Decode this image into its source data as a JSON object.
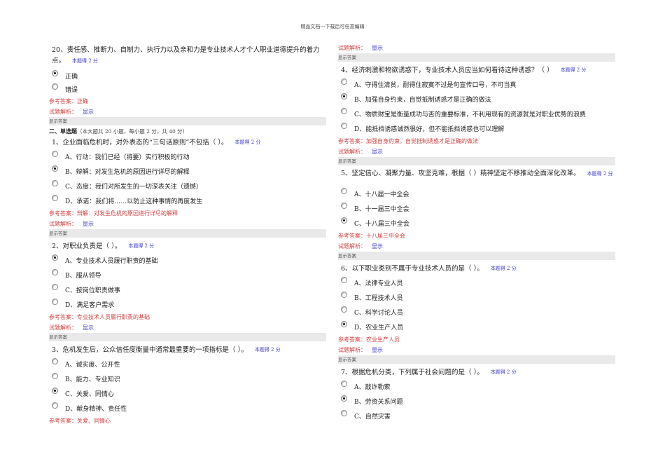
{
  "header": "精品文档---下载后可任意编辑",
  "labels": {
    "ref": "参考答案：",
    "analysis": "试题解析：",
    "show": "显示",
    "show_answer": "显示答案"
  },
  "section": {
    "title": "二、单选题",
    "note": "（本大题共 20 小题，每小题 2 分，共 40 分）"
  },
  "q20": {
    "text": "20、责任感、推断力、自制力、执行力以及亲和力是专业技术人才个人职业道德提升的着力点。",
    "score": "本题得 2 分",
    "options": [
      "正确",
      "错误"
    ],
    "selected": 0,
    "answer": "正确"
  },
  "left": [
    {
      "text": "1、企业面临危机时，对外表态的“三句话原则”不包括（ ）。",
      "score": "本题得 2 分",
      "options": [
        "A、行动：我们已经（将要）实行积极的行动",
        "B、辩解：对发生危机的原因进行详尽的解释",
        "C、态度：我们对所发生的一切深表关注（遗憾）",
        "D、承诺：我们将……以防止这种事情的再度发生"
      ],
      "selected": 1,
      "answer": "辩解：对发生危机的原因进行详尽的解释"
    },
    {
      "text": "2、对职业负责是（ ）。",
      "score": "本题得 2 分",
      "options": [
        "A、专业技术人员履行职责的基础",
        "B、服从领导",
        "C、按岗位职责做事",
        "D、满足客户需求"
      ],
      "selected": 0,
      "answer": "专业技术人员履行职责的基础"
    },
    {
      "text": "3、危机发生后，公众信任度衡量中通常最重要的一项指标是（ ）。",
      "score": "本题得 2 分",
      "options": [
        "A、诚实度、公开性",
        "B、能力、专业知识",
        "C、关爱、同情心",
        "D、献身精神、责任性"
      ],
      "selected": 2,
      "answer": "关爱、同情心"
    }
  ],
  "right": [
    {
      "text": "4、经济刺激和物欲诱惑下，专业技术人员应当如何看待这种诱惑？（ ）",
      "score": "本题得 2 分",
      "options": [
        "A、守得住清贫，耐得住寂寞不过是句宣传口号，不可当真",
        "B、加强自身约束，自觉抵制诱惑才是正确的做法",
        "C、物质财宝是衡量成功与否的重要标准，不利用现有的资源就是对职业优势的浪费",
        "D、能抵挡诱惑诚然很好，但不能抵挡诱惑也可以理解"
      ],
      "selected": 1,
      "answer": "加强自身约束，自觉抵制诱惑才是正确的做法"
    },
    {
      "text": "5、坚定信心、凝聚力量、攻坚克难，根据（ ）精神坚定不移推动全面深化改革。",
      "score": "本题得 2 分",
      "options": [
        "A、十八届一中全会",
        "B、十一届三中全会",
        "C、十八届三中全会"
      ],
      "selected": 2,
      "answer": "十八届三中全会"
    },
    {
      "text": "6、以下职业类别不属于专业技术人员的是（ ）。",
      "score": "本题得 2 分",
      "options": [
        "A、法律专业人员",
        "B、工程技术人员",
        "C、科学讨论人员",
        "D、农业生产人员"
      ],
      "selected": 3,
      "answer": "农业生产人员"
    },
    {
      "text": "7、根据危机分类，下列属于社会问题的是（ ）。",
      "score": "本题得 2 分",
      "options": [
        "A、敲诈勒索",
        "B、劳资关系问题",
        "C、自然灾害"
      ],
      "selected": 1
    }
  ]
}
